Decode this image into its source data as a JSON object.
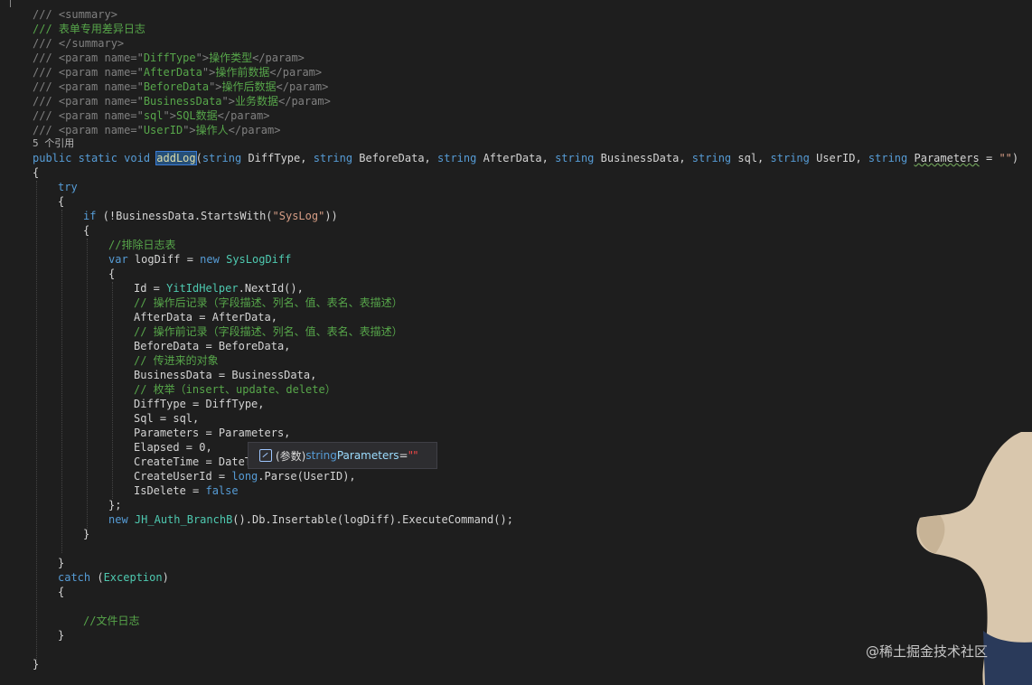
{
  "code": {
    "doc": {
      "summary_open": "/// <summary>",
      "summary_text": "/// 表单专用差异日志",
      "summary_close": "/// </summary>",
      "params": [
        {
          "prefix": "/// <param name=\"",
          "name": "DiffType",
          "mid": "\">",
          "desc": "操作类型",
          "end": "</param>"
        },
        {
          "prefix": "/// <param name=\"",
          "name": "AfterData",
          "mid": "\">",
          "desc": "操作前数据",
          "end": "</param>"
        },
        {
          "prefix": "/// <param name=\"",
          "name": "BeforeData",
          "mid": "\">",
          "desc": "操作后数据",
          "end": "</param>"
        },
        {
          "prefix": "/// <param name=\"",
          "name": "BusinessData",
          "mid": "\">",
          "desc": "业务数据",
          "end": "</param>"
        },
        {
          "prefix": "/// <param name=\"",
          "name": "sql",
          "mid": "\">",
          "desc": "SQL数据",
          "end": "</param>"
        },
        {
          "prefix": "/// <param name=\"",
          "name": "UserID",
          "mid": "\">",
          "desc": "操作人",
          "end": "</param>"
        }
      ]
    },
    "references": "5 个引用",
    "signature": {
      "modifiers": "public static void ",
      "method": "addLog",
      "open": "(",
      "p1_type": "string",
      "p1": " DiffType, ",
      "p2_type": "string",
      "p2": " BeforeData, ",
      "p3_type": "string",
      "p3": " AfterData, ",
      "p4_type": "string",
      "p4": " BusinessData, ",
      "p5_type": "string",
      "p5": " sql, ",
      "p6_type": "string",
      "p6": " UserID, ",
      "p7_type": "string",
      "p7": " ",
      "p7_name": "Parameters",
      "p7_eq": " = ",
      "p7_default": "\"\"",
      "close": ")"
    },
    "brace_open": "{",
    "brace_close": "}",
    "try_kw": "try",
    "if_kw": "if",
    "if_rest": " (!BusinessData.StartsWith(",
    "if_str": "\"SysLog\"",
    "if_end": "))",
    "cmt_exclude": "//排除日志表",
    "var_kw": "var",
    "var_rest": " logDiff = ",
    "new_kw": "new",
    "sys_type": "SysLogDiff",
    "id_pre": "Id = ",
    "id_type": "YitIdHelper",
    "id_post": ".NextId(),",
    "cmt_after": "// 操作后记录（字段描述、列名、值、表名、表描述）",
    "after_line": "AfterData = AfterData,",
    "cmt_before": "// 操作前记录（字段描述、列名、值、表名、表描述）",
    "before_line": "BeforeData = BeforeData,",
    "cmt_obj": "// 传进来的对象",
    "business_line": "BusinessData = BusinessData,",
    "cmt_enum": "// 枚举（insert、update、delete）",
    "difftype_line": "DiffType = DiffType,",
    "sql_line": "Sql = sql,",
    "params_line": "Parameters = Parameters,",
    "elapsed_line": "Elapsed = 0,",
    "createtime_line": "CreateTime = DateT",
    "createuser_pre": "CreateUserId = ",
    "long_kw": "long",
    "createuser_post": ".Parse(UserID),",
    "isdelete_pre": "IsDelete = ",
    "false_kw": "false",
    "init_close": "};",
    "exec_new": "new",
    "exec_type": "JH_Auth_BranchB",
    "exec_rest": "().Db.Insertable(logDiff).ExecuteCommand();",
    "catch_kw": "catch",
    "catch_open": " (",
    "catch_type": "Exception",
    "catch_close": ")",
    "cmt_file": "//文件日志"
  },
  "tooltip": {
    "icon": "parameter-icon",
    "prefix": "(参数) ",
    "type_kw": "string",
    "name": " Parameters",
    "eq": " = ",
    "value": "\"\""
  },
  "watermark": "@稀土掘金技术社区",
  "colors": {
    "background": "#1e1e1e",
    "keyword": "#569cd6",
    "type": "#4ec9b0",
    "comment": "#57a64a",
    "string": "#d69d85"
  }
}
